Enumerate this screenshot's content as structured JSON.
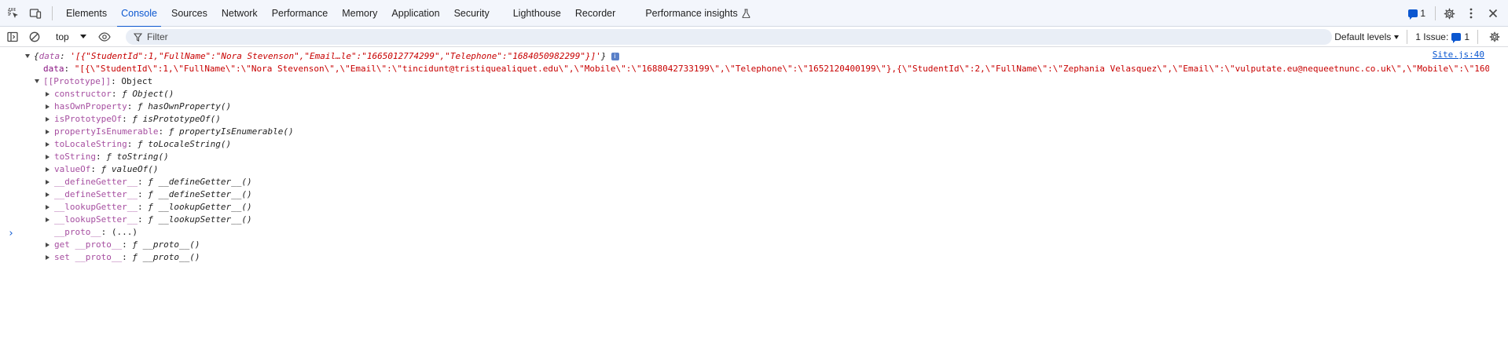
{
  "tabbar": {
    "tabs": [
      "Elements",
      "Console",
      "Sources",
      "Network",
      "Performance",
      "Memory",
      "Application",
      "Security",
      "Lighthouse",
      "Recorder",
      "Performance insights"
    ],
    "active_tab": "Console",
    "issues_count": "1",
    "icons": [
      "inspect-element-icon",
      "device-toolbar-icon",
      "flask-icon",
      "message-icon",
      "gear-icon",
      "more-vertical-icon",
      "close-icon"
    ]
  },
  "toolbar": {
    "context": "top",
    "filter_placeholder": "Filter",
    "levels": "Default levels",
    "issues_label": "1 Issue:",
    "issues_count": "1"
  },
  "console": {
    "source_link": "Site.js:40",
    "summary_open": "{",
    "summary_key": "data",
    "summary_value": "'[{\"StudentId\":1,\"FullName\":\"Nora Stevenson\",\"Email…le\":\"1665012774299\",\"Telephone\":\"1684050982299\"}]'",
    "summary_close": "}",
    "data_key": "data",
    "data_value": "\"[{\\\"StudentId\\\":1,\\\"FullName\\\":\\\"Nora Stevenson\\\",\\\"Email\\\":\\\"tincidunt@tristiquealiquet.edu\\\",\\\"Mobile\\\":\\\"1688042733199\\\",\\\"Telephone\\\":\\\"1652120400199\\\"},{\\\"StudentId\\\":2,\\\"FullName\\\":\\\"Zephania Velasquez\\\",\\\"Email\\\":\\\"vulputate.eu@nequeetnunc.co.uk\\\",\\\"Mobile\\\":\\\"1600",
    "prototype_label": "[[Prototype]]",
    "prototype_value": "Object",
    "props": [
      {
        "name": "constructor",
        "value": "ƒ Object()",
        "expandable": true
      },
      {
        "name": "hasOwnProperty",
        "value": "ƒ hasOwnProperty()",
        "expandable": true
      },
      {
        "name": "isPrototypeOf",
        "value": "ƒ isPrototypeOf()",
        "expandable": true
      },
      {
        "name": "propertyIsEnumerable",
        "value": "ƒ propertyIsEnumerable()",
        "expandable": true
      },
      {
        "name": "toLocaleString",
        "value": "ƒ toLocaleString()",
        "expandable": true
      },
      {
        "name": "toString",
        "value": "ƒ toString()",
        "expandable": true
      },
      {
        "name": "valueOf",
        "value": "ƒ valueOf()",
        "expandable": true
      },
      {
        "name": "__defineGetter__",
        "value": "ƒ __defineGetter__()",
        "expandable": true
      },
      {
        "name": "__defineSetter__",
        "value": "ƒ __defineSetter__()",
        "expandable": true
      },
      {
        "name": "__lookupGetter__",
        "value": "ƒ __lookupGetter__()",
        "expandable": true
      },
      {
        "name": "__lookupSetter__",
        "value": "ƒ __lookupSetter__()",
        "expandable": true
      },
      {
        "name": "__proto__",
        "value": "(...)",
        "expandable": false
      },
      {
        "name": "get __proto__",
        "value": "ƒ __proto__()",
        "expandable": true
      },
      {
        "name": "set __proto__",
        "value": "ƒ __proto__()",
        "expandable": true
      }
    ],
    "prompt": "›"
  }
}
